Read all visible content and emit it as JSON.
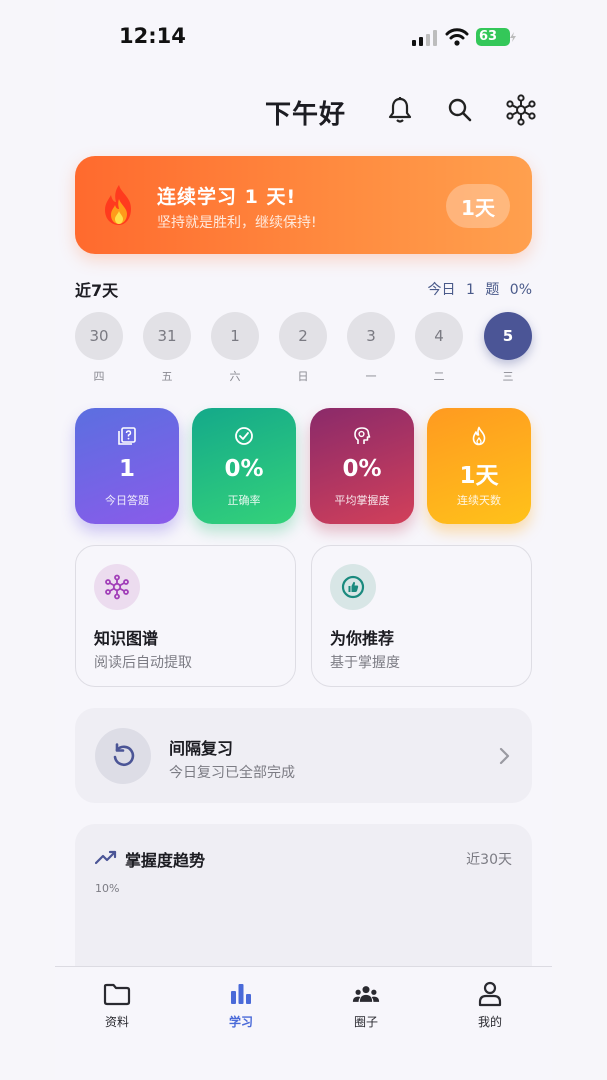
{
  "status_bar": {
    "time": "12:14",
    "battery": "63"
  },
  "header": {
    "greeting": "下午好"
  },
  "streak_banner": {
    "title": "连续学习 1 天!",
    "subtitle": "坚持就是胜利，继续保持!",
    "pill": "1天"
  },
  "week": {
    "label": "近7天",
    "today_label": "今日",
    "today_count": "1 题",
    "today_percent": "0%",
    "days": [
      {
        "date": "30",
        "weekday": "四"
      },
      {
        "date": "31",
        "weekday": "五"
      },
      {
        "date": "1",
        "weekday": "六"
      },
      {
        "date": "2",
        "weekday": "日"
      },
      {
        "date": "3",
        "weekday": "一"
      },
      {
        "date": "4",
        "weekday": "二"
      },
      {
        "date": "5",
        "weekday": "三"
      }
    ]
  },
  "stats": [
    {
      "value": "1",
      "label": "今日答题",
      "icon": "question-card-icon"
    },
    {
      "value": "0%",
      "label": "正确率",
      "icon": "check-circle-icon"
    },
    {
      "value": "0%",
      "label": "平均掌握度",
      "icon": "brain-head-icon"
    },
    {
      "value": "1天",
      "label": "连续天数",
      "icon": "flame-icon"
    }
  ],
  "features": [
    {
      "title": "知识图谱",
      "subtitle": "阅读后自动提取",
      "icon": "graph-network-icon"
    },
    {
      "title": "为你推荐",
      "subtitle": "基于掌握度",
      "icon": "thumbs-up-icon"
    }
  ],
  "review": {
    "title": "间隔复习",
    "subtitle": "今日复习已全部完成"
  },
  "trend": {
    "title": "掌握度趋势",
    "range": "近30天",
    "y_tick": "10%"
  },
  "tabs": [
    {
      "label": "资料",
      "icon": "folder-icon"
    },
    {
      "label": "学习",
      "icon": "bar-chart-icon",
      "active": true
    },
    {
      "label": "圈子",
      "icon": "group-icon"
    },
    {
      "label": "我的",
      "icon": "person-icon"
    }
  ],
  "colors": {
    "accent": "#4a6ad8",
    "today_circle": "#4b5596",
    "streak_orange": "#ff7a36"
  }
}
